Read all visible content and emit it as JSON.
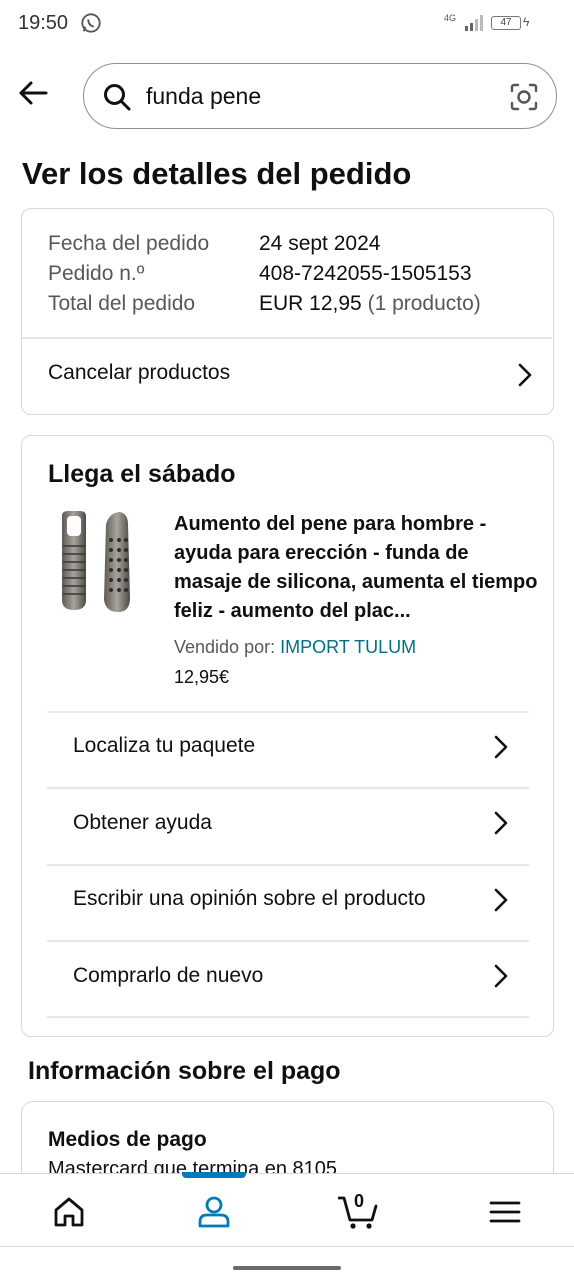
{
  "status_bar": {
    "time": "19:50",
    "network": "4G",
    "battery": "47"
  },
  "search": {
    "query": "funda pene"
  },
  "page_title": "Ver los detalles del pedido",
  "order_summary": {
    "date_label": "Fecha del pedido",
    "date_value": "24 sept 2024",
    "number_label": "Pedido n.º",
    "number_value": "408-7242055-1505153",
    "total_label": "Total del pedido",
    "total_value": "EUR 12,95",
    "total_count": "(1 producto)",
    "cancel_label": "Cancelar productos"
  },
  "shipment": {
    "heading": "Llega el sábado",
    "product_name": "Aumento del pene para hombre - ayuda para erección - funda de masaje de silicona, aumenta el tiempo feliz - aumento del plac...",
    "sold_by_label": "Vendido por:",
    "seller": "IMPORT TULUM",
    "price": "12,95€",
    "actions": [
      "Localiza tu paquete",
      "Obtener ayuda",
      "Escribir una opinión sobre el producto",
      "Comprarlo de nuevo"
    ]
  },
  "payment": {
    "heading": "Información sobre el pago",
    "methods_label": "Medios de pago",
    "method_value": "Mastercard que termina en 8105"
  },
  "bottom_nav": {
    "cart_count": "0",
    "active": "account"
  },
  "colors": {
    "link": "#007185",
    "active_tab": "#007bb8",
    "border": "#d5d9d9"
  }
}
